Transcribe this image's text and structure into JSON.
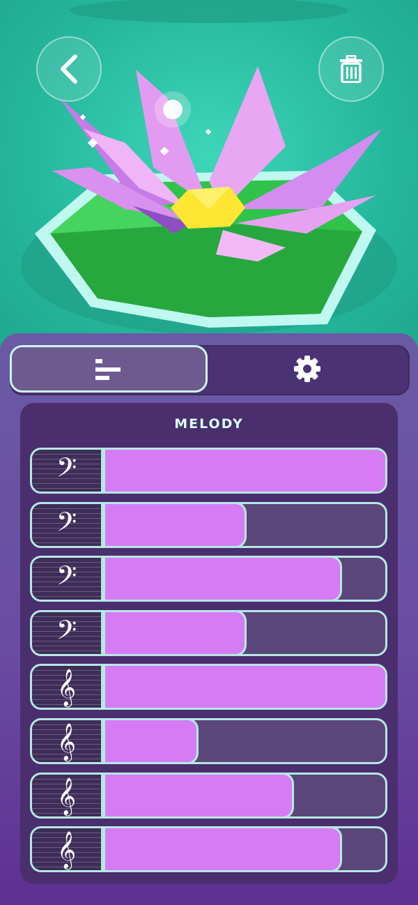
{
  "header": {
    "back_icon": "chevron-left-icon",
    "delete_icon": "trash-icon"
  },
  "tabs": [
    {
      "name": "tracks",
      "icon": "bars-icon",
      "active": true
    },
    {
      "name": "settings",
      "icon": "gear-icon",
      "active": false
    }
  ],
  "panel": {
    "title": "MELODY",
    "tracks": [
      {
        "clef": "𝄢",
        "clef_name": "bass-clef-icon",
        "level": 1.0
      },
      {
        "clef": "𝄢",
        "clef_name": "bass-clef-icon",
        "level": 0.5
      },
      {
        "clef": "𝄢",
        "clef_name": "bass-clef-icon",
        "level": 0.84
      },
      {
        "clef": "𝄢",
        "clef_name": "bass-clef-icon",
        "level": 0.5
      },
      {
        "clef": "𝄞",
        "clef_name": "treble-clef-icon",
        "level": 1.0
      },
      {
        "clef": "𝄞",
        "clef_name": "treble-clef-icon",
        "level": 0.33
      },
      {
        "clef": "𝄞",
        "clef_name": "treble-clef-icon",
        "level": 0.67
      },
      {
        "clef": "𝄞",
        "clef_name": "treble-clef-icon",
        "level": 0.84
      }
    ]
  },
  "colors": {
    "water": "#2bbfa4",
    "fill": "#d57cf5",
    "outline": "#b7e8e2",
    "panel": "#6a4ca2"
  }
}
